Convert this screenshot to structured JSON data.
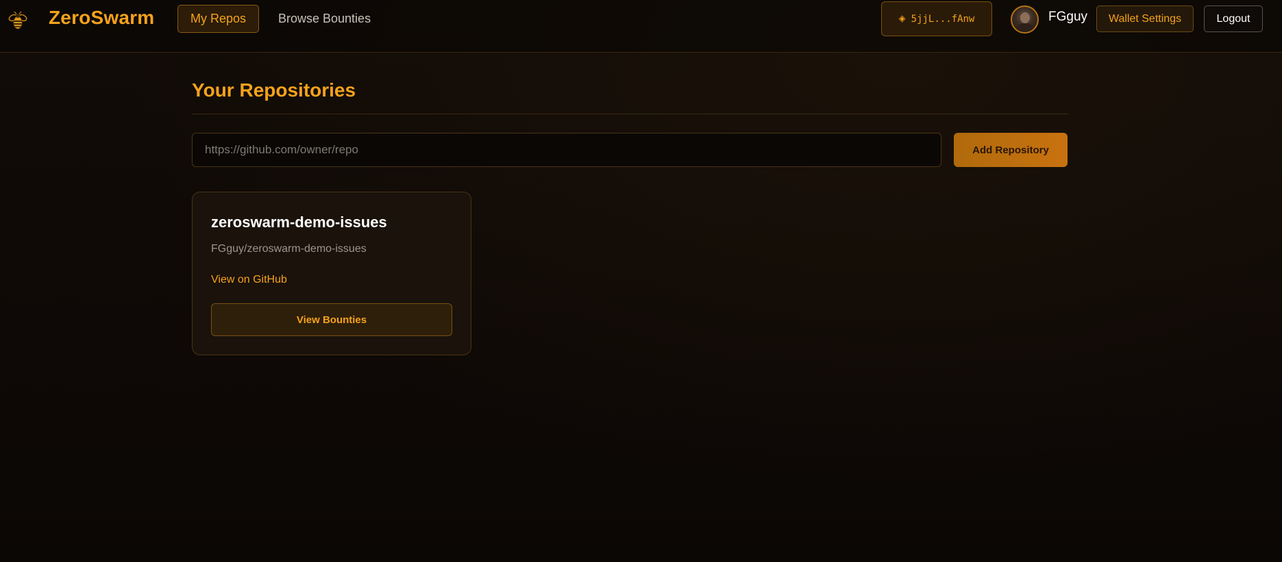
{
  "app": {
    "brand": "ZeroSwarm",
    "logo_icon": "bee-icon",
    "accent_color": "#f5a21b"
  },
  "nav": {
    "items": [
      {
        "label": "My Repos",
        "active": true
      },
      {
        "label": "Browse Bounties",
        "active": false
      }
    ]
  },
  "header": {
    "wallet": {
      "icon": "diamond-icon",
      "address": "5jjL...fAnw"
    },
    "avatar_icon": "user-avatar",
    "username": "FGguy",
    "wallet_settings_label": "Wallet Settings",
    "logout_label": "Logout"
  },
  "main": {
    "title": "Your Repositories",
    "repo_input": {
      "placeholder": "https://github.com/owner/repo",
      "value": ""
    },
    "add_button_label": "Add Repository",
    "repos": [
      {
        "name": "zeroswarm-demo-issues",
        "full_name": "FGguy/zeroswarm-demo-issues",
        "github_link_label": "View on GitHub",
        "bounties_button_label": "View Bounties"
      }
    ]
  }
}
